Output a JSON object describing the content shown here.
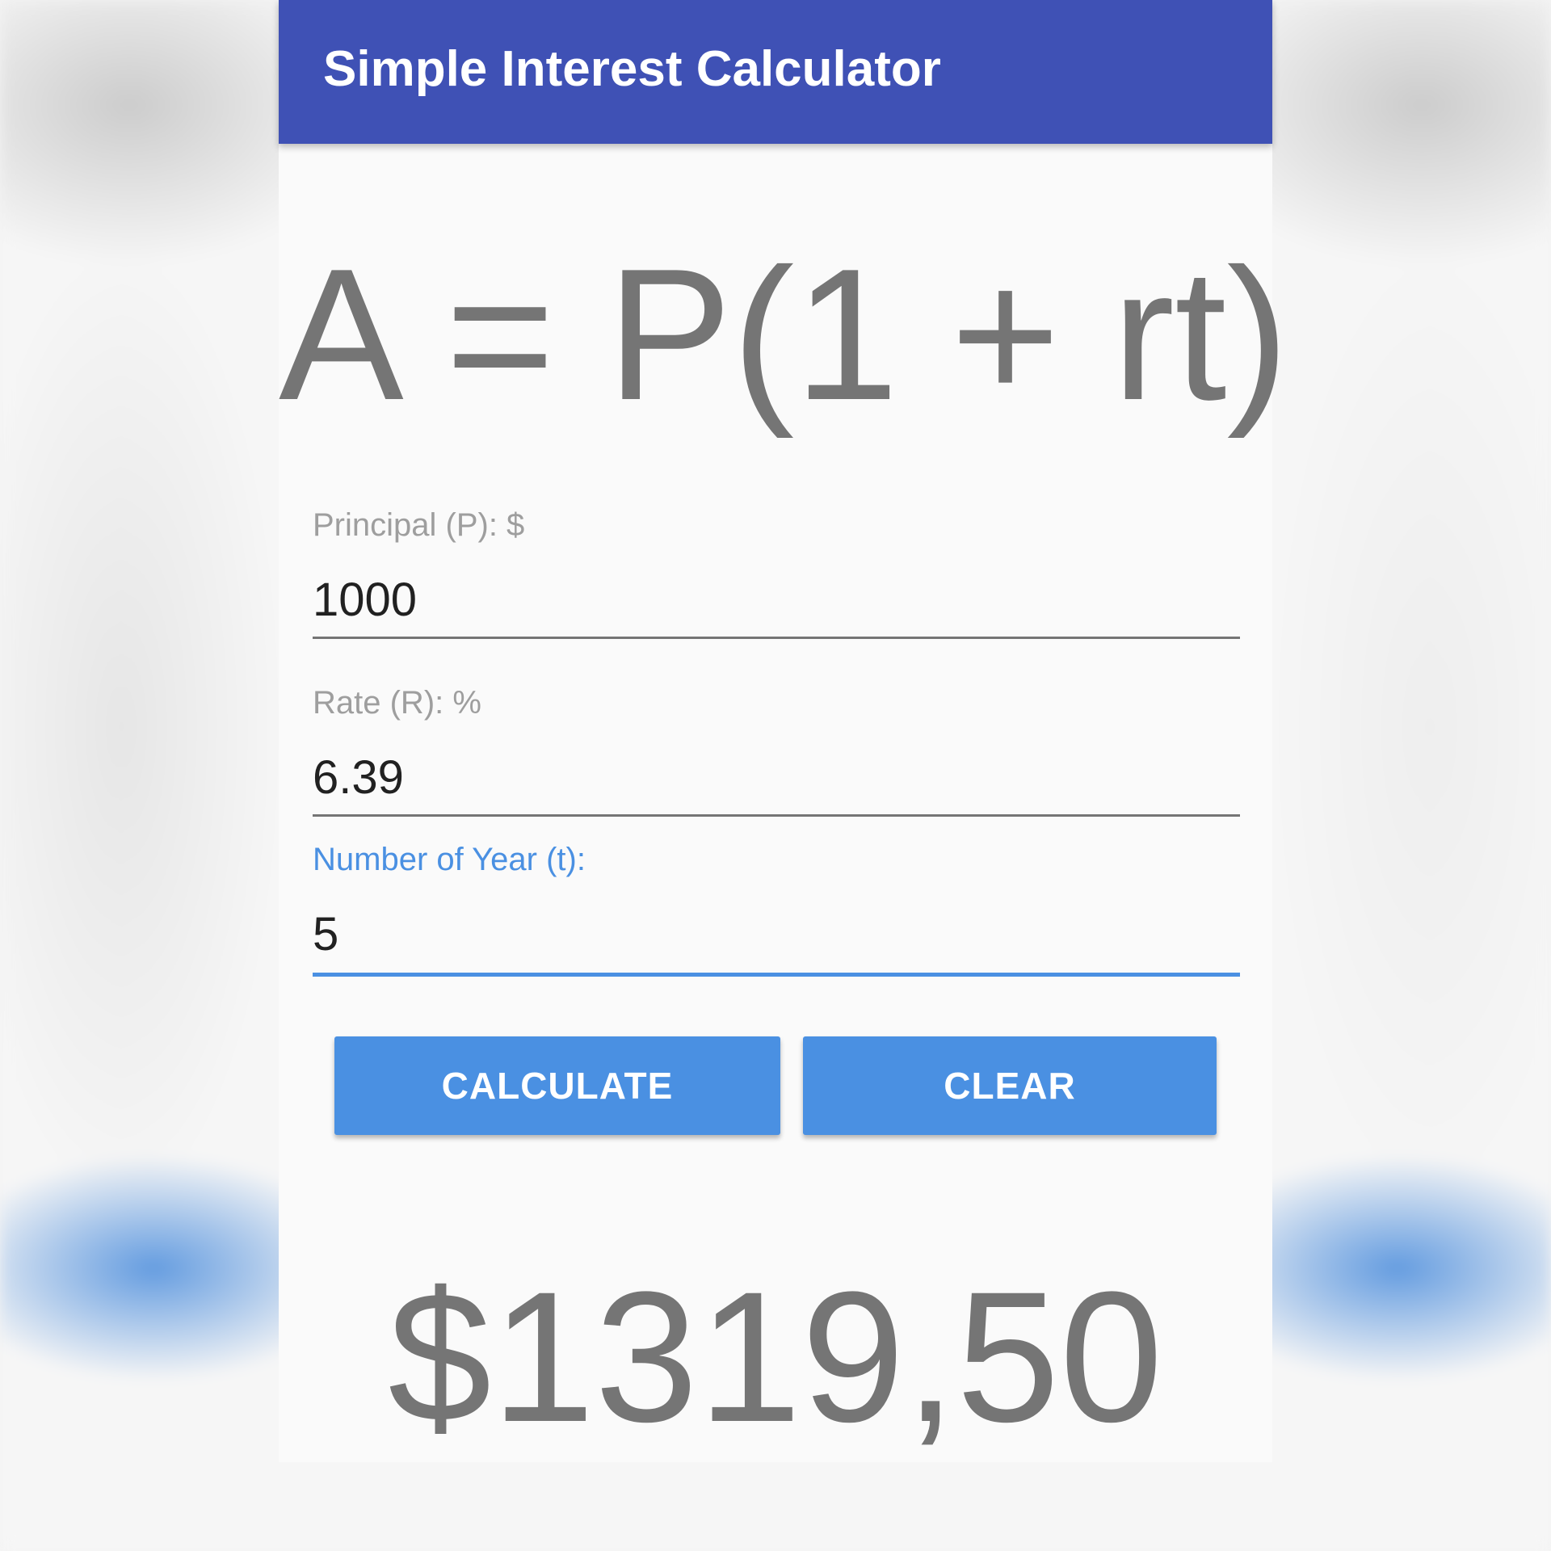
{
  "appbar": {
    "title": "Simple Interest Calculator",
    "color": "#3f51b5"
  },
  "formula": "A = P(1 + rt)",
  "fields": {
    "principal": {
      "label": "Principal (P): $",
      "value": "1000"
    },
    "rate": {
      "label": "Rate (R): %",
      "value": "6.39"
    },
    "years": {
      "label": "Number of Year (t):",
      "value": "5",
      "focused": true
    }
  },
  "buttons": {
    "calculate": "CALCULATE",
    "clear": "CLEAR",
    "color": "#4a90e2"
  },
  "result": "$1319,50"
}
